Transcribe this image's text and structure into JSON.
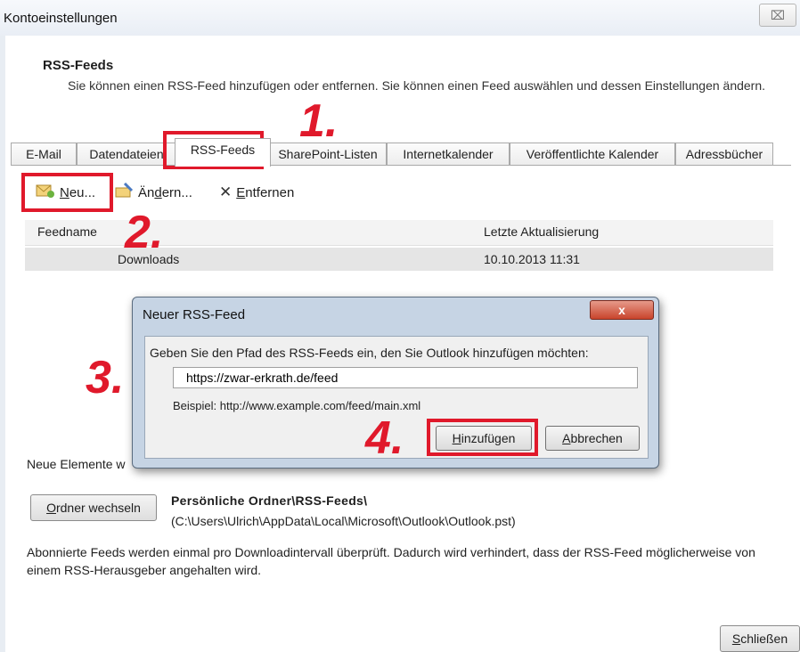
{
  "window": {
    "title": "Kontoeinstellungen",
    "close_glyph": "⌧"
  },
  "header": {
    "title": "RSS-Feeds",
    "description": "Sie können einen RSS-Feed hinzufügen oder entfernen. Sie können einen Feed auswählen und dessen Einstellungen ändern."
  },
  "tabs": [
    {
      "label": "E-Mail"
    },
    {
      "label": "Datendateien"
    },
    {
      "label": "RSS-Feeds",
      "active": true
    },
    {
      "label": "SharePoint-Listen"
    },
    {
      "label": "Internetkalender"
    },
    {
      "label": "Veröffentlichte Kalender"
    },
    {
      "label": "Adressbücher"
    }
  ],
  "toolbar": {
    "new": {
      "access_key": "N",
      "rest": "eu...",
      "icon": "new-feed-icon"
    },
    "change": {
      "prefix": "Än",
      "access_key": "d",
      "rest": "ern...",
      "icon": "change-feed-icon"
    },
    "remove": {
      "access_key": "E",
      "rest": "ntfernen",
      "icon": "delete-x-icon",
      "glyph": "✕"
    }
  },
  "list": {
    "columns": [
      "Feedname",
      "Letzte Aktualisierung"
    ],
    "rows": [
      {
        "name": "Downloads",
        "updated": "10.10.2013 11:31"
      }
    ]
  },
  "lower": {
    "new_items_label": "Neue Elemente w",
    "change_folder": {
      "access_key": "O",
      "rest": "rdner wechseln"
    },
    "folder_name": "Persönliche Ordner\\RSS-Feeds\\",
    "folder_path": "(C:\\Users\\Ulrich\\AppData\\Local\\Microsoft\\Outlook\\Outlook.pst)",
    "info": "Abonnierte Feeds werden einmal pro Downloadintervall überprüft. Dadurch wird verhindert, dass der RSS-Feed möglicherweise von einem RSS-Herausgeber angehalten wird.",
    "close": {
      "prefix": "",
      "access_key": "S",
      "rest": "chließen"
    }
  },
  "dialog": {
    "title": "Neuer RSS-Feed",
    "close_glyph": "x",
    "prompt": "Geben Sie den Pfad des RSS-Feeds ein, den Sie Outlook hinzufügen möchten:",
    "url_value": "https://zwar-erkrath.de/feed",
    "example": "Beispiel: http://www.example.com/feed/main.xml",
    "add": {
      "access_key": "H",
      "rest": "inzufügen"
    },
    "cancel": {
      "access_key": "A",
      "rest": "bbrechen"
    }
  },
  "annotations": [
    "1.",
    "2.",
    "3.",
    "4."
  ],
  "colors": {
    "annotation_red": "#e0192b",
    "dialog_frame": "#c6d4e4",
    "selected_row": "#e5e5e5"
  }
}
